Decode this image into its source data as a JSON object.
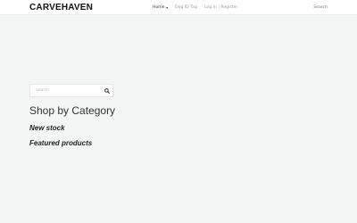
{
  "header": {
    "logo": "CARVEHAVEN",
    "nav": {
      "home": "Home",
      "dog_id_tag": "Dog ID Tag",
      "login": "Log in",
      "separator": "|",
      "register": "Register"
    },
    "search_label": "Search"
  },
  "sidebar": {
    "search": {
      "placeholder": "Search",
      "value": ""
    },
    "icons": {
      "search_button": "search-icon",
      "home_dropdown": "chevron-down-icon"
    }
  },
  "main": {
    "category_title": "Shop by Category",
    "new_stock": "New stock",
    "featured_products": "Featured products"
  }
}
